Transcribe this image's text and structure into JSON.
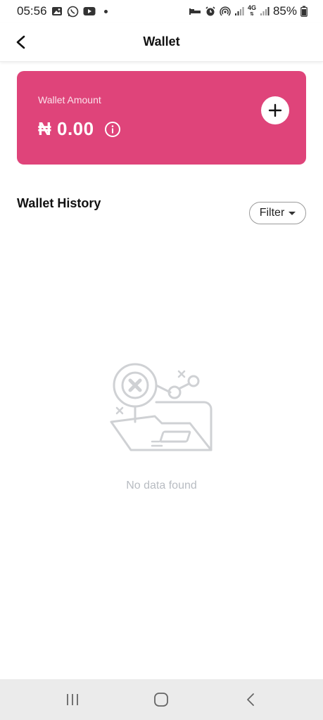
{
  "status_bar": {
    "time": "05:56",
    "battery": "85%",
    "network": "4G"
  },
  "app_bar": {
    "title": "Wallet"
  },
  "wallet_card": {
    "label": "Wallet Amount",
    "amount": "₦ 0.00",
    "color": "#df447a"
  },
  "history": {
    "title": "Wallet History",
    "filter_label": "Filter",
    "empty_text": "No data found"
  },
  "icons": {
    "back": "back-arrow-icon",
    "info": "info-icon",
    "add": "plus-icon",
    "empty": "empty-folder-illustration"
  }
}
